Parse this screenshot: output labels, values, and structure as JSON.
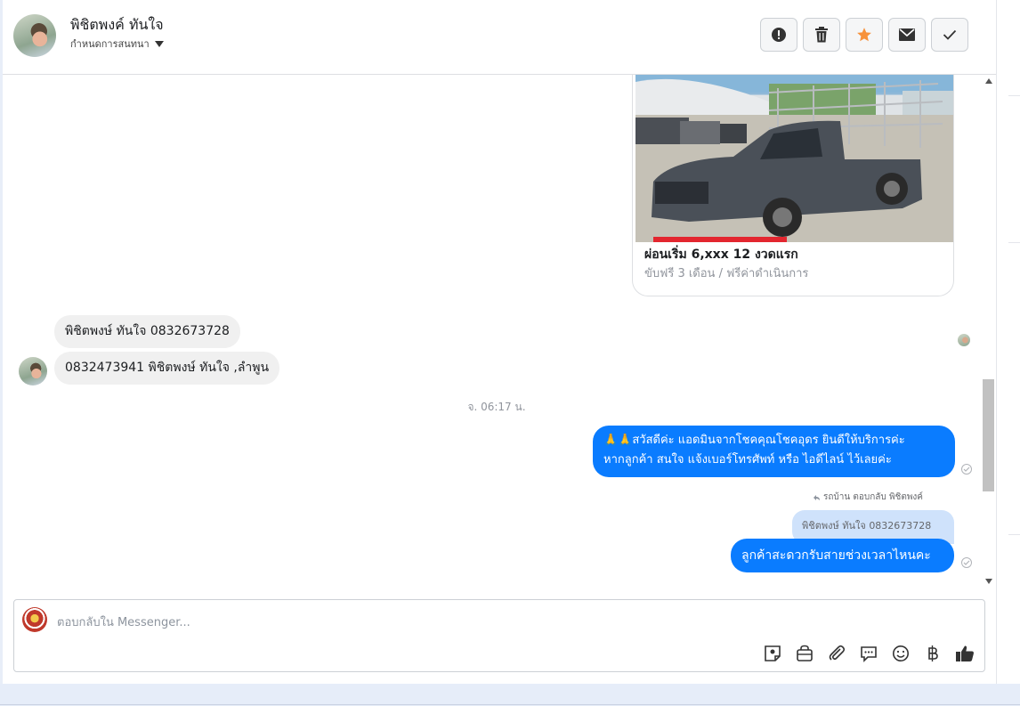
{
  "header": {
    "name": "พิชิตพงค์ ทันใจ",
    "assign_label": "กำหนดการสนทนา"
  },
  "card": {
    "title": "ผ่อนเริ่ม 6,xxx 12 งวดแรก",
    "subtitle": "ขับฟรี 3 เดือน / ฟรีค่าดำเนินการ"
  },
  "messages": {
    "incoming_1": "พิชิตพงษ์  ทันใจ  0832673728",
    "incoming_2": "0832473941  พิชิตพงษ์  ทันใจ   ,ลำพูน",
    "timestamp": "จ. 06:17 น.",
    "outgoing_1_line1": "🙏🙏สวัสดีค่ะ แอดมินจากโชคคุณโชคอุดร ยินดีให้บริการค่ะ",
    "outgoing_1_line2": "หากลูกค้า สนใจ แจ้งเบอร์โทรศัพท์ หรือ ไอดีไลน์  ไว้เลยค่ะ",
    "replied_to": "รถบ้าน ตอบกลับ พิชิตพงค์",
    "quoted": "พิชิตพงษ์ ทันใจ 0832673728",
    "outgoing_2": "ลูกค้าสะดวกรับสายช่วงเวลาไหนคะ"
  },
  "composer": {
    "placeholder": "ตอบกลับใน Messenger..."
  },
  "icons": {
    "header": [
      "alert-icon",
      "trash-icon",
      "star-icon",
      "mail-icon",
      "check-icon"
    ],
    "composer": [
      "sticker-icon",
      "shop-icon",
      "attach-icon",
      "saved-reply-icon",
      "emoji-icon",
      "baht-icon",
      "like-icon"
    ]
  },
  "colors": {
    "accent": "#0a7cff",
    "star": "#f7923b"
  }
}
